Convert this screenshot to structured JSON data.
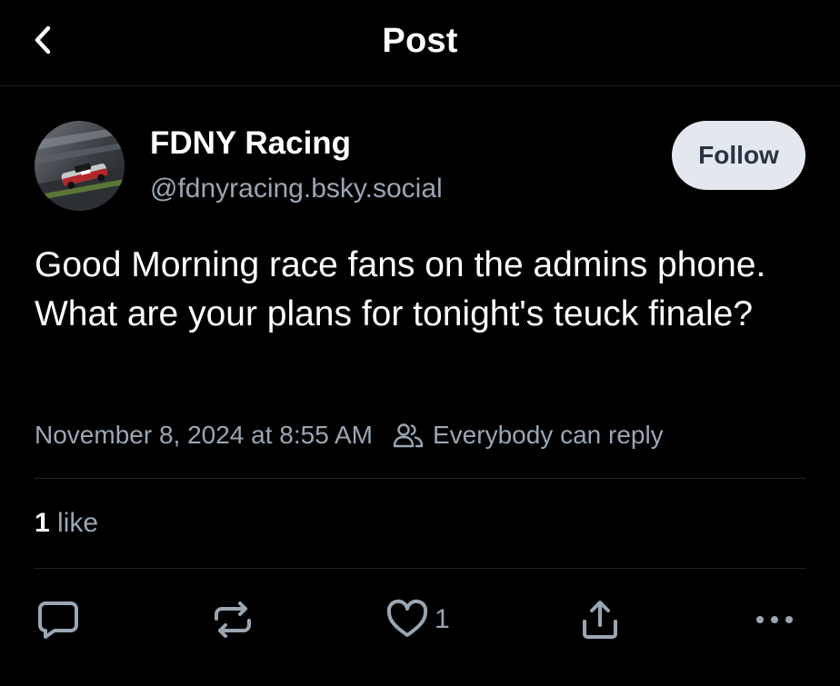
{
  "header": {
    "title": "Post",
    "back_icon": "chevron-left-icon"
  },
  "author": {
    "name": "FDNY Racing",
    "handle": "@fdnyracing.bsky.social",
    "avatar_description": "race-car-avatar"
  },
  "follow_button": {
    "label": "Follow"
  },
  "post": {
    "text": "Good Morning race fans on the admins phone. What are your plans for tonight's teuck finale?",
    "timestamp": "November 8, 2024 at 8:55 AM",
    "reply_setting": "Everybody can reply"
  },
  "stats": {
    "likes_count": "1",
    "likes_label": "like"
  },
  "actions": {
    "reply_icon": "comment-icon",
    "repost_icon": "repost-icon",
    "like_icon": "heart-icon",
    "like_count": "1",
    "share_icon": "share-icon",
    "more_icon": "more-options-icon"
  },
  "colors": {
    "background": "#000000",
    "text_primary": "#ffffff",
    "text_secondary": "#9aa6b2",
    "follow_bg": "#e3e8ee",
    "follow_text": "#2b3440",
    "divider": "#1f2328"
  }
}
